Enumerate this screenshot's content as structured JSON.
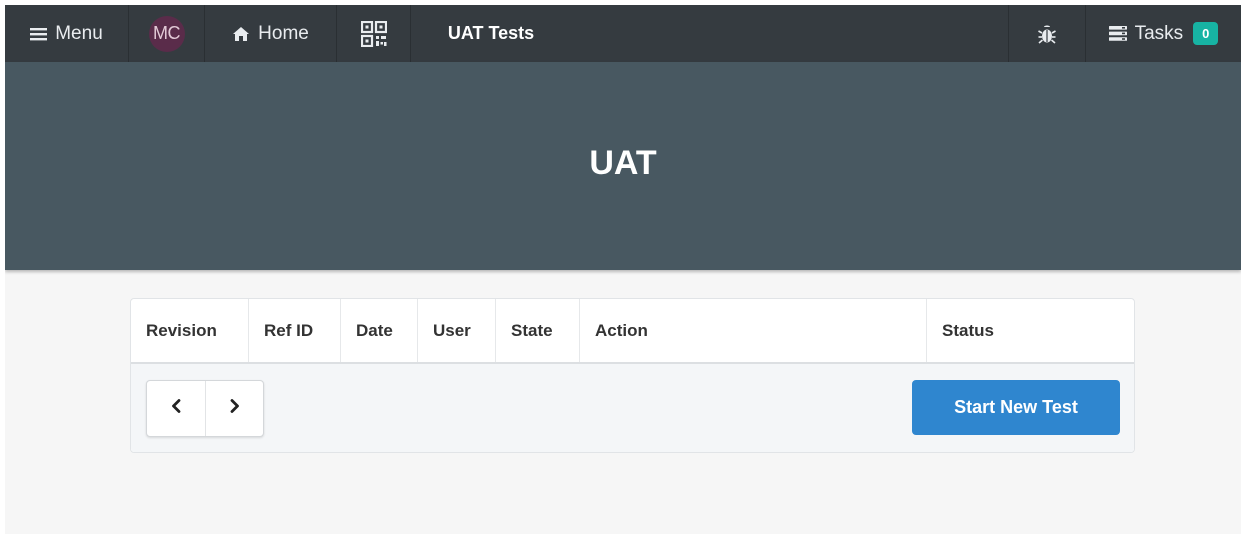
{
  "navbar": {
    "menu_label": "Menu",
    "avatar_initials": "MC",
    "home_label": "Home",
    "page_title": "UAT Tests",
    "tasks_label": "Tasks",
    "tasks_count": "0",
    "icons": {
      "menu": "hamburger-icon",
      "home": "home-icon",
      "qr": "qr-code-icon",
      "bug": "bug-icon",
      "tasks": "tasks-list-icon"
    }
  },
  "hero": {
    "title": "UAT"
  },
  "table": {
    "columns": [
      "Revision",
      "Ref ID",
      "Date",
      "User",
      "State",
      "Action",
      "Status"
    ],
    "rows": []
  },
  "footer": {
    "prev_icon": "chevron-left-icon",
    "next_icon": "chevron-right-icon",
    "start_button_label": "Start New Test"
  },
  "colors": {
    "navbar_bg": "#353b40",
    "hero_bg": "#485861",
    "primary_button": "#2f86cf",
    "badge": "#17b3a3",
    "avatar_bg": "#5a2c4a"
  }
}
